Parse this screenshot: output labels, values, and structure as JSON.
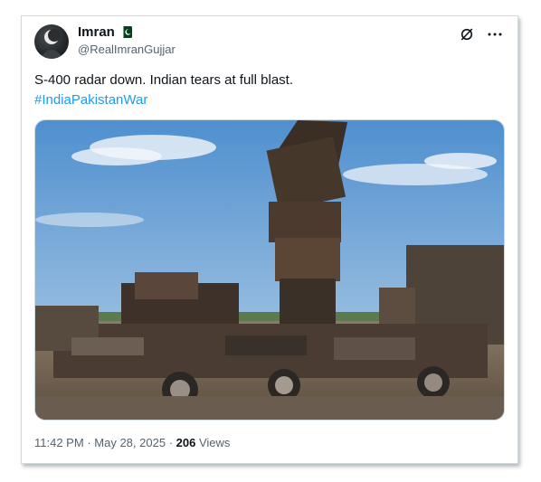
{
  "tweet": {
    "author_name": "Imran",
    "author_handle": "@RealImranGujjar",
    "text": "S-400 radar down. Indian tears at full blast.",
    "hashtag": "#IndiaPakistanWar",
    "time": "11:42 PM",
    "date": "May 28, 2025",
    "separator": "·",
    "views_count": "206",
    "views_label": "Views",
    "flag_icon": "pakistan-flag-icon",
    "media_icon": "burned-radar-vehicle-photo",
    "more_icon": "more-dots-icon",
    "grok_icon": "grok-slash-icon",
    "colors": {
      "link": "#1d9bf0",
      "text": "#0f1419",
      "muted": "#536471"
    }
  }
}
